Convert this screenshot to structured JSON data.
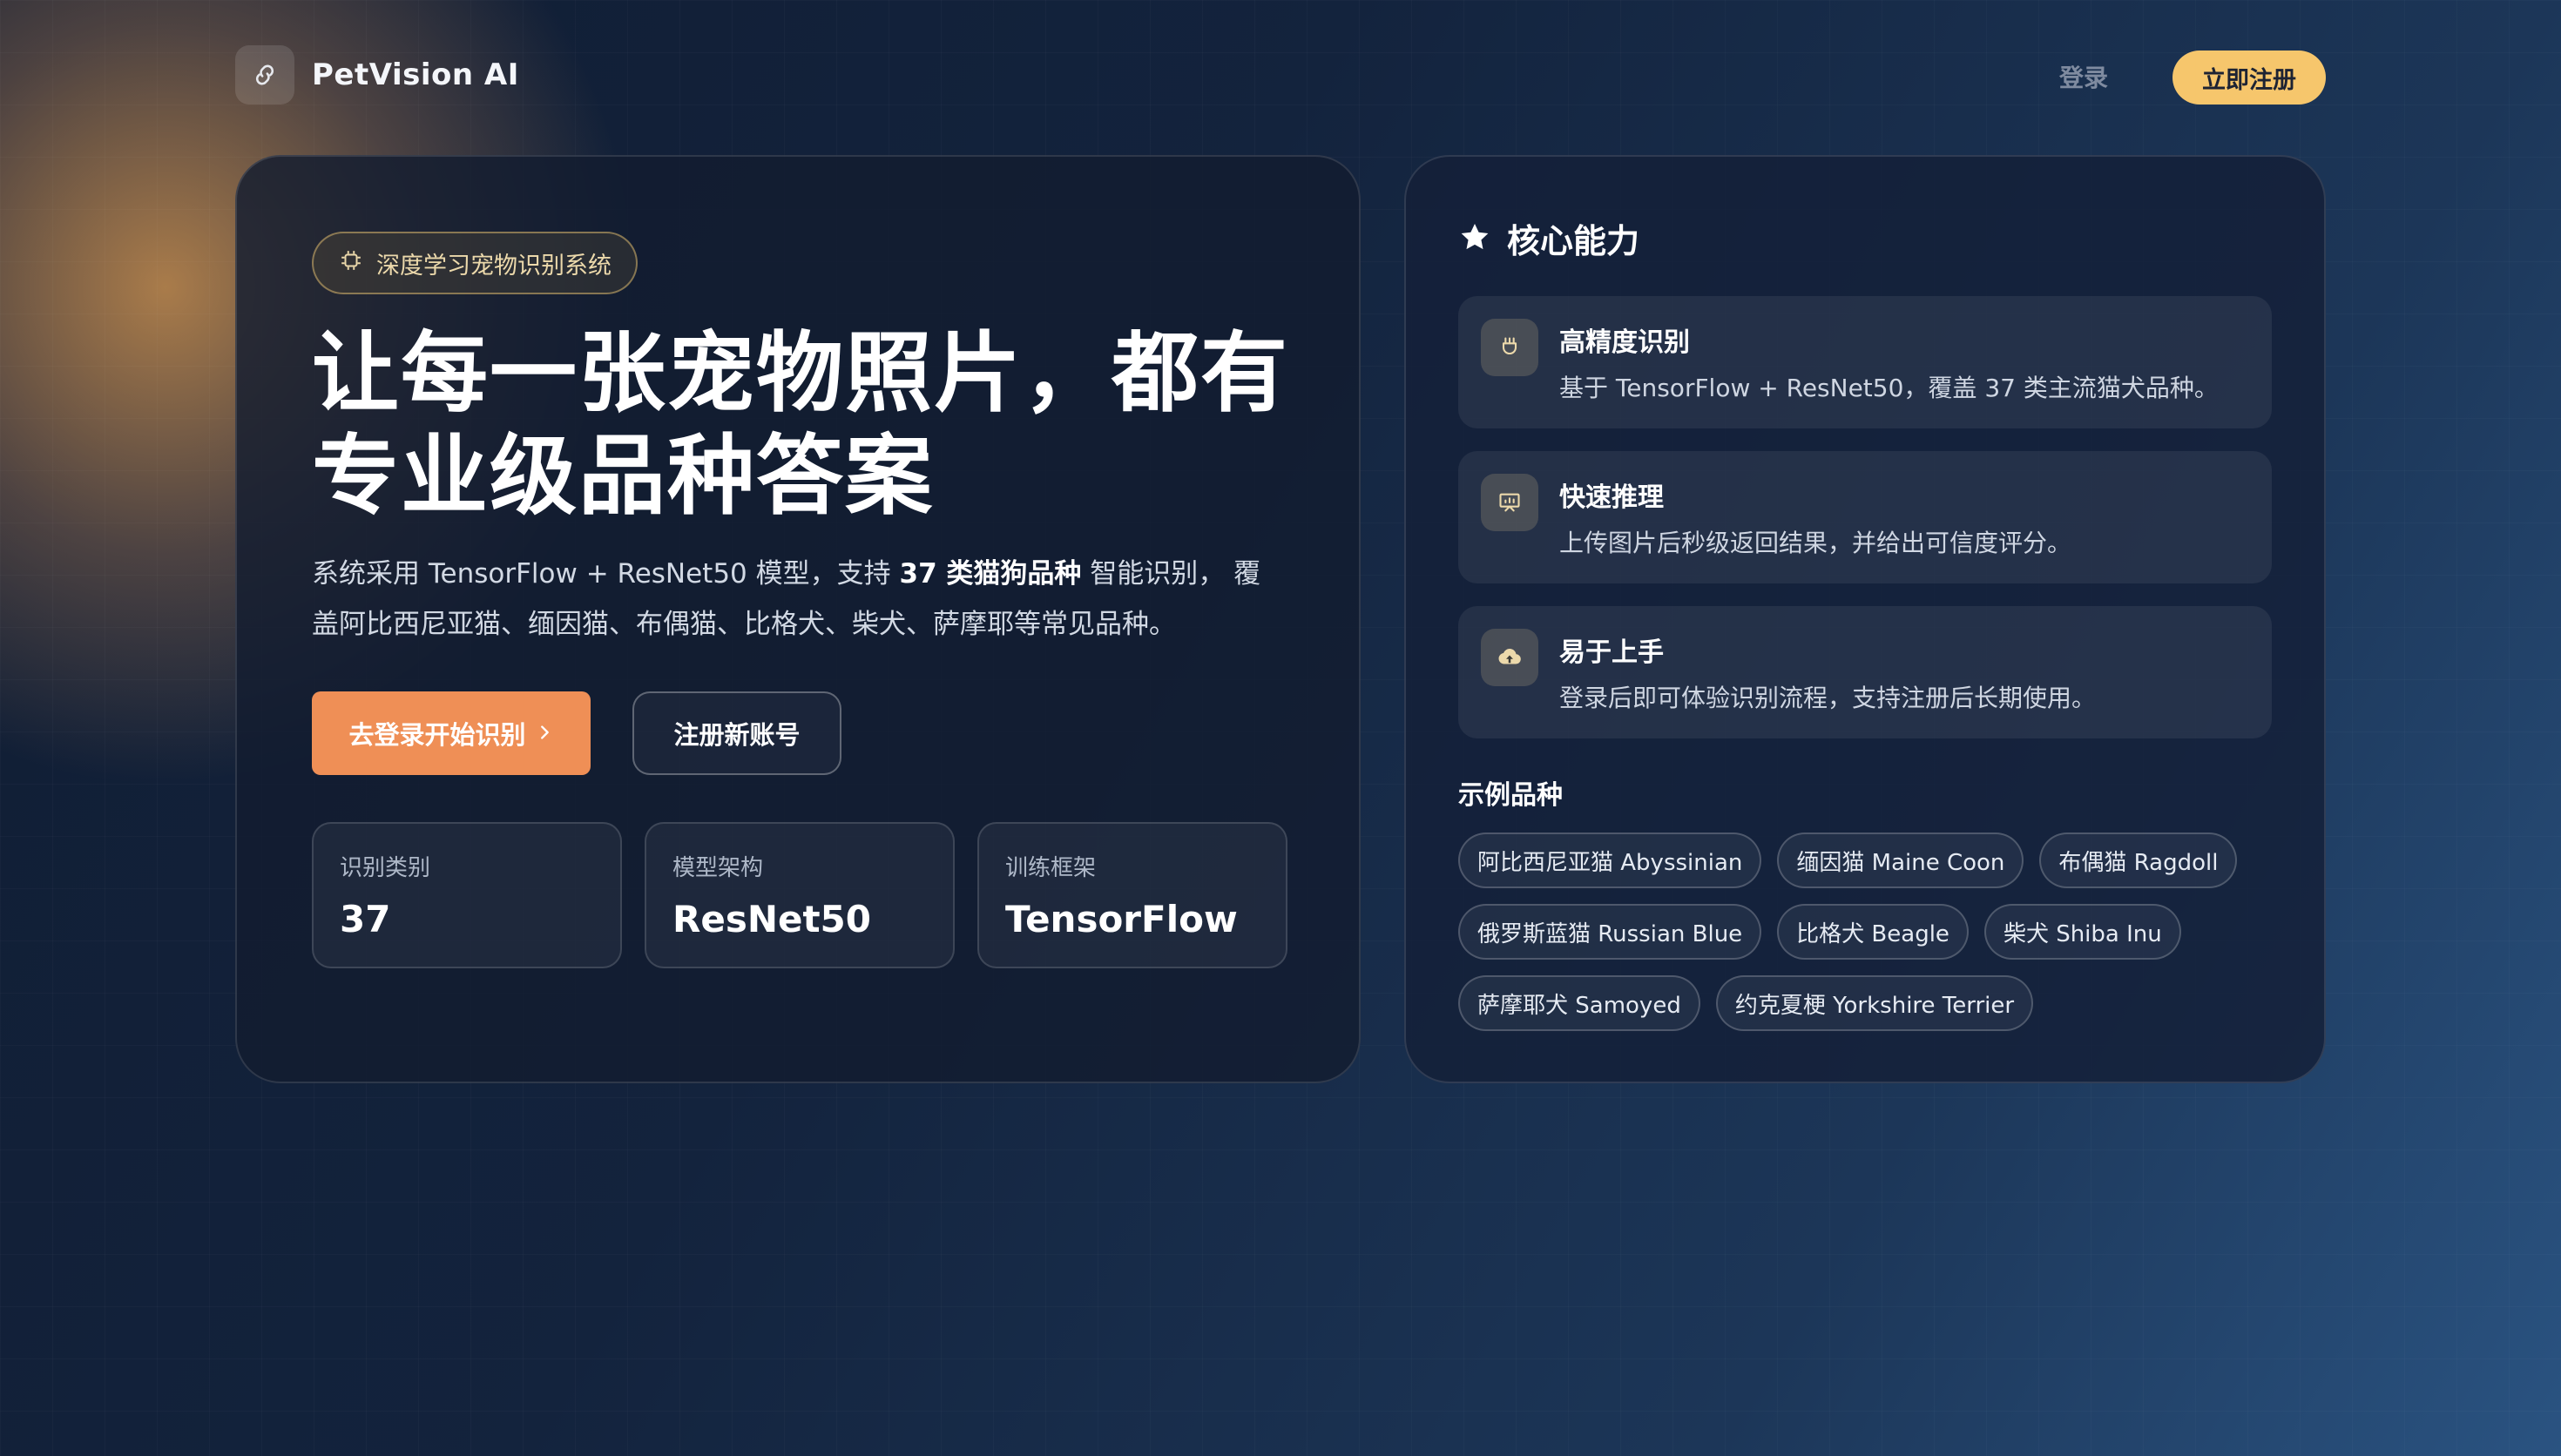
{
  "nav": {
    "brand": "PetVision AI",
    "login": "登录",
    "signup": "立即注册"
  },
  "hero": {
    "badge": "深度学习宠物识别系统",
    "title_line1": "让每一张宠物照片，都有",
    "title_line2": "专业级品种答案",
    "desc_before": "系统采用 TensorFlow + ResNet50 模型，支持 ",
    "desc_bold": "37 类猫狗品种",
    "desc_after": " 智能识别， 覆盖阿比西尼亚猫、缅因猫、布偶猫、比格犬、柴犬、萨摩耶等常见品种。",
    "primary_btn": "去登录开始识别",
    "secondary_btn": "注册新账号",
    "stats": [
      {
        "label": "识别类别",
        "value": "37"
      },
      {
        "label": "模型架构",
        "value": "ResNet50"
      },
      {
        "label": "训练框架",
        "value": "TensorFlow"
      }
    ]
  },
  "features": {
    "title": "核心能力",
    "items": [
      {
        "title": "高精度识别",
        "desc": "基于 TensorFlow + ResNet50，覆盖 37 类主流猫犬品种。",
        "icon": "paw-icon"
      },
      {
        "title": "快速推理",
        "desc": "上传图片后秒级返回结果，并给出可信度评分。",
        "icon": "presentation-icon"
      },
      {
        "title": "易于上手",
        "desc": "登录后即可体验识别流程，支持注册后长期使用。",
        "icon": "cloud-upload-icon"
      }
    ],
    "examples_title": "示例品种",
    "tags": [
      "阿比西尼亚猫 Abyssinian",
      "缅因猫 Maine Coon",
      "布偶猫 Ragdoll",
      "俄罗斯蓝猫 Russian Blue",
      "比格犬 Beagle",
      "柴犬 Shiba Inu",
      "萨摩耶犬 Samoyed",
      "约克夏梗 Yorkshire Terrier"
    ]
  },
  "colors": {
    "accent_orange": "#ef8f56",
    "accent_yellow": "#f6c66c",
    "badge_gold": "#ecd9ab"
  }
}
